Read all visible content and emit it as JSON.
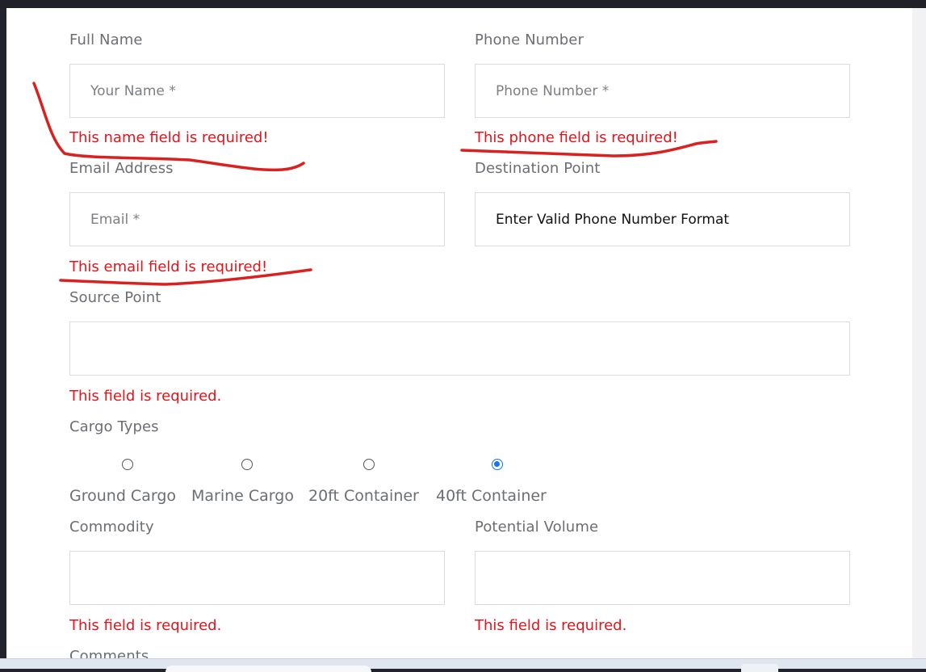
{
  "form": {
    "full_name": {
      "label": "Full Name",
      "placeholder": "Your Name *",
      "value": "",
      "error": "This name field is required!"
    },
    "phone": {
      "label": "Phone Number",
      "placeholder": "Phone Number *",
      "value": "",
      "error": "This phone field is required!"
    },
    "email": {
      "label": "Email Address",
      "placeholder": "Email *",
      "value": "",
      "error": "This email field is required!"
    },
    "destination": {
      "label": "Destination Point",
      "placeholder": "",
      "value": "Enter Valid Phone Number Format"
    },
    "source": {
      "label": "Source Point",
      "placeholder": "",
      "value": "",
      "error": "This field is required."
    },
    "cargo": {
      "label": "Cargo Types",
      "options": [
        {
          "label": "Ground Cargo",
          "checked": false
        },
        {
          "label": "Marine Cargo",
          "checked": false
        },
        {
          "label": "20ft Container",
          "checked": false
        },
        {
          "label": "40ft Container",
          "checked": true
        }
      ]
    },
    "commodity": {
      "label": "Commodity",
      "placeholder": "",
      "value": "",
      "error": "This field is required."
    },
    "volume": {
      "label": "Potential Volume",
      "placeholder": "",
      "value": "",
      "error": "This field is required."
    },
    "comments": {
      "label": "Comments"
    }
  },
  "colors": {
    "error": "#e3141b",
    "annotation": "#d9211f",
    "radio_checked": "#1a73e8"
  }
}
